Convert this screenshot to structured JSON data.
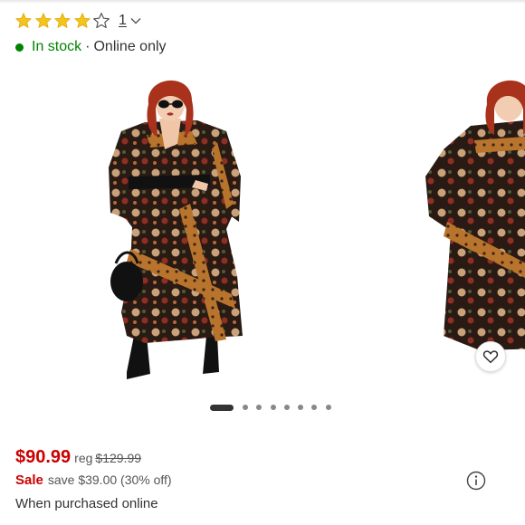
{
  "rating": {
    "stars_filled": 4,
    "stars_total": 5,
    "count": "1",
    "star_color": "#f5c31c"
  },
  "stock": {
    "status": "In stock",
    "separator": "·",
    "channel": "Online only",
    "status_color": "#008300"
  },
  "gallery": {
    "current_image": 1,
    "total_images": 8,
    "images": [
      {
        "alt": "Model wearing black floral print maxi wrap dress with black hat belt and handbag"
      },
      {
        "alt": "Model wearing black floral print maxi wrap dress, alternate view"
      }
    ]
  },
  "pricing": {
    "current": "$90.99",
    "reg_label": "reg",
    "regular": "$129.99",
    "sale_label": "Sale",
    "save_text": "save $39.00 (30% off)",
    "note": "When purchased online",
    "sale_color": "#cc0000"
  },
  "icons": {
    "favorite": "heart-icon",
    "info": "info-icon",
    "expand": "chevron-down-icon"
  }
}
